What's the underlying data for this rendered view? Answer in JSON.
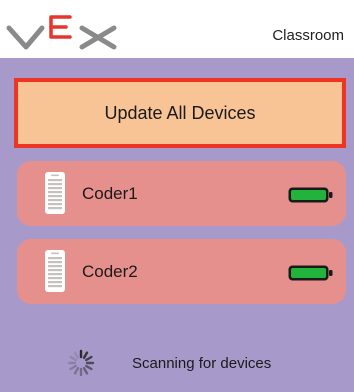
{
  "header": {
    "title": "Classroom",
    "logo_icon": "vex-logo-icon"
  },
  "update_button": {
    "label": "Update All Devices"
  },
  "devices": [
    {
      "name": "Coder1",
      "icon": "coder-device-icon",
      "battery_icon": "battery-full-icon",
      "battery_level": 1.0
    },
    {
      "name": "Coder2",
      "icon": "coder-device-icon",
      "battery_icon": "battery-full-icon",
      "battery_level": 1.0
    }
  ],
  "scan": {
    "status": "Scanning for devices",
    "icon": "loading-spinner-icon"
  },
  "colors": {
    "header_bg": "#ffffff",
    "main_bg": "#a79acb",
    "update_button_bg": "#f8c495",
    "update_button_border": "#ee3423",
    "device_card_bg": "#e6908d",
    "battery_fill": "#22b33c",
    "logo_grey": "#8a8a8a",
    "logo_red": "#e5352c"
  }
}
